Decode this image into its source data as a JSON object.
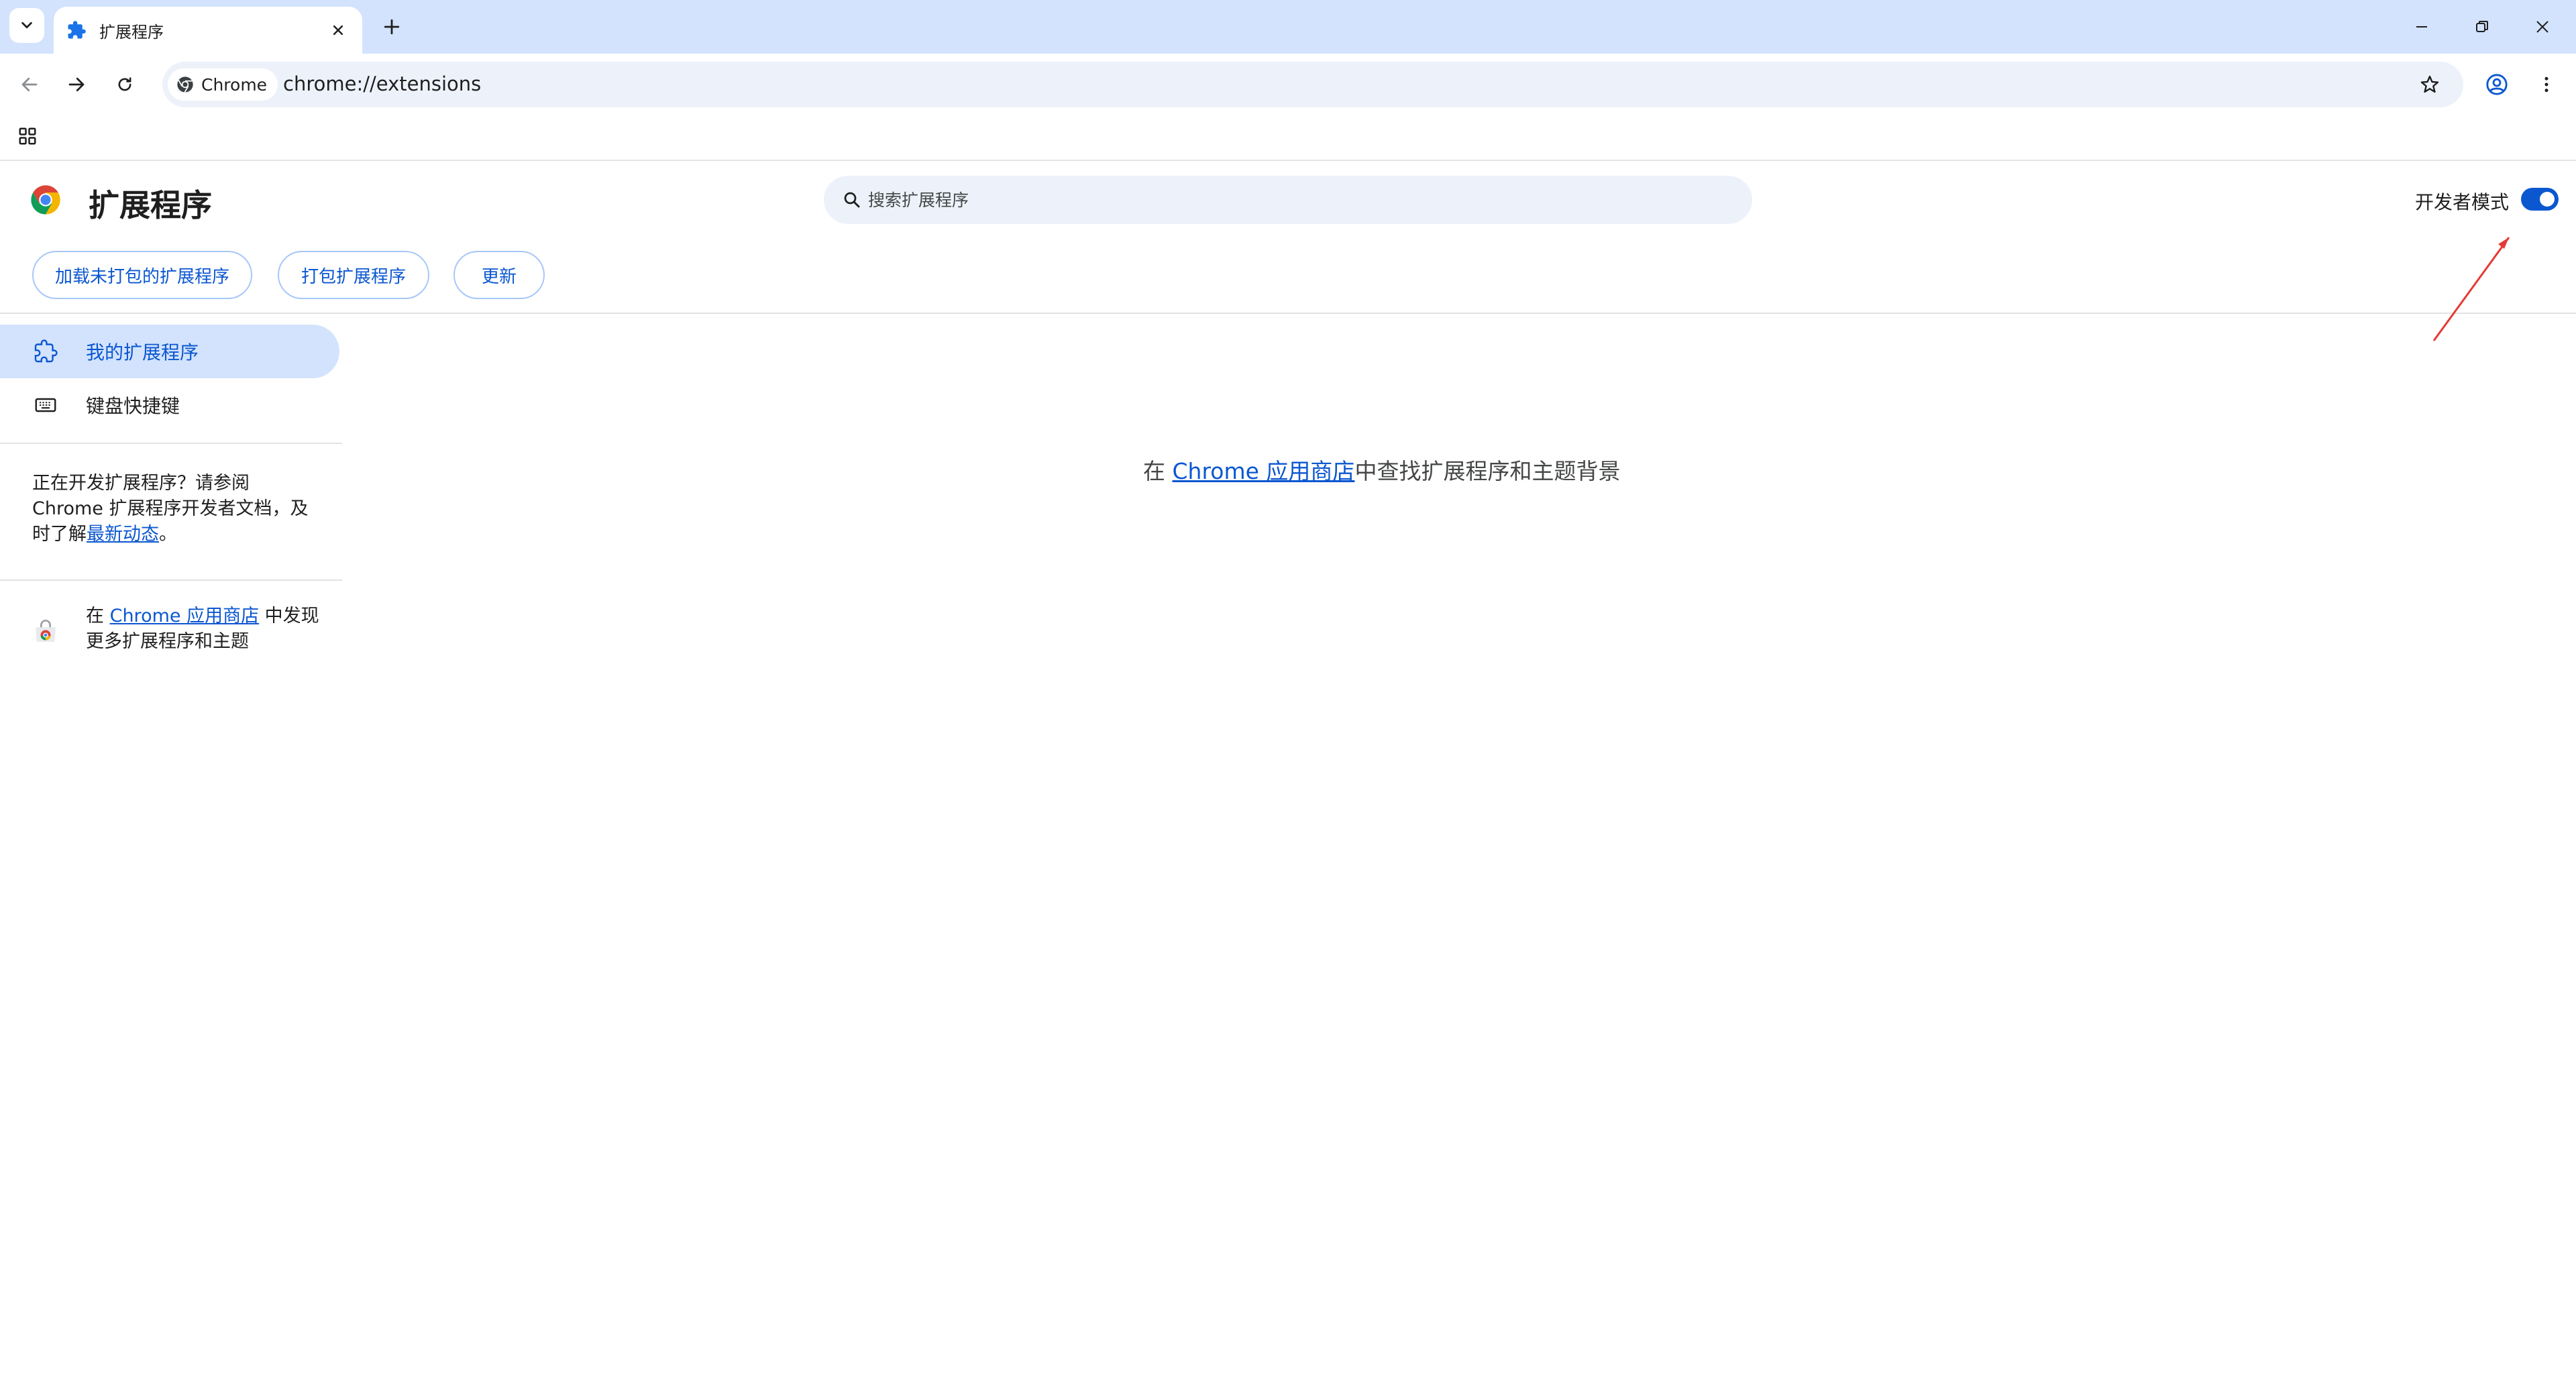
{
  "window": {
    "tab_title": "扩展程序",
    "minimize_symbol": "—",
    "restore_symbol": "❐",
    "close_symbol": "✕"
  },
  "toolbar": {
    "chip_label": "Chrome",
    "url": "chrome://extensions"
  },
  "extensions": {
    "title": "扩展程序",
    "search_placeholder": "搜索扩展程序",
    "developer_mode_label": "开发者模式",
    "developer_mode_on": true,
    "buttons": {
      "load_unpacked": "加载未打包的扩展程序",
      "pack": "打包扩展程序",
      "update": "更新"
    }
  },
  "sidebar": {
    "items": [
      {
        "label": "我的扩展程序",
        "active": true
      },
      {
        "label": "键盘快捷键",
        "active": false
      }
    ],
    "dev_text_1": "正在开发扩展程序？请参阅 Chrome 扩展程序开发者文档，及时了解",
    "dev_link": "最新动态",
    "dev_text_2": "。",
    "store_prefix": "在 ",
    "store_link": "Chrome 应用商店",
    "store_suffix": " 中发现更多扩展程序和主题"
  },
  "main": {
    "prefix": "在 ",
    "link": "Chrome 应用商店",
    "suffix": "中查找扩展程序和主题背景"
  },
  "colors": {
    "accent": "#0b57d0",
    "tabstrip": "#d3e3fd",
    "annotation": "#e53935"
  }
}
